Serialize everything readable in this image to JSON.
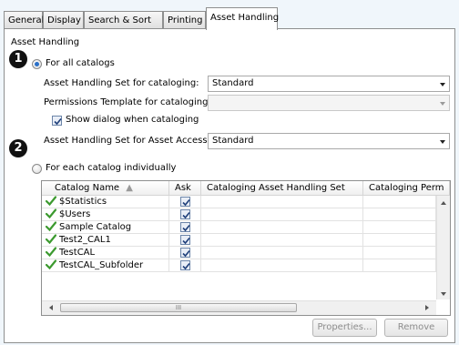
{
  "tabs": [
    {
      "label": "General"
    },
    {
      "label": "Display"
    },
    {
      "label": "Search & Sort"
    },
    {
      "label": "Printing"
    },
    {
      "label": "Asset Handling"
    }
  ],
  "group_title": "Asset Handling",
  "badges": [
    "1",
    "2"
  ],
  "all_catalogs": {
    "radio_label": "For all catalogs",
    "set_label": "Asset Handling Set for cataloging:",
    "set_value": "Standard",
    "perm_label": "Permissions Template for cataloging:",
    "perm_value": "",
    "show_dialog_label": "Show dialog when cataloging",
    "access_label": "Asset Handling Set for Asset Access:",
    "access_value": "Standard"
  },
  "individual": {
    "radio_label": "For each catalog individually"
  },
  "table": {
    "columns": [
      "Catalog Name",
      "Ask",
      "Cataloging Asset Handling Set",
      "Cataloging Perm"
    ],
    "rows": [
      {
        "name": "$Statistics",
        "ask": true
      },
      {
        "name": "$Users",
        "ask": true
      },
      {
        "name": "Sample Catalog",
        "ask": true
      },
      {
        "name": "Test2_CAL1",
        "ask": true
      },
      {
        "name": "TestCAL",
        "ask": true
      },
      {
        "name": "TestCAL_Subfolder",
        "ask": true
      }
    ],
    "hscroll_thumb_glyph": "III"
  },
  "buttons": {
    "properties": "Properties...",
    "remove": "Remove"
  },
  "colors": {
    "background": "#f0f6fb",
    "check_green": "#3c9a2f",
    "radio_selected": "#2a6fc8"
  }
}
